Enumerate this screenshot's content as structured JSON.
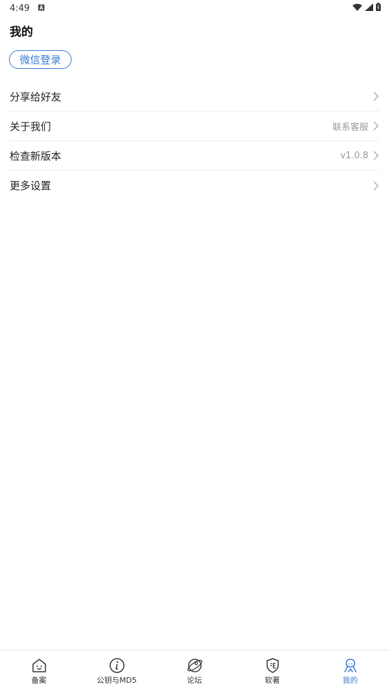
{
  "status_bar": {
    "time": "4:49"
  },
  "page_title": "我的",
  "login_button": "微信登录",
  "menu": [
    {
      "label": "分享给好友",
      "value": ""
    },
    {
      "label": "关于我们",
      "value": "联系客服"
    },
    {
      "label": "检查新版本",
      "value": "v1.0.8"
    },
    {
      "label": "更多设置",
      "value": ""
    }
  ],
  "bottom_nav": [
    {
      "label": "备案",
      "icon": "house-face-icon",
      "active": false
    },
    {
      "label": "公钥与MD5",
      "icon": "info-icon",
      "active": false
    },
    {
      "label": "论坛",
      "icon": "planet-icon",
      "active": false
    },
    {
      "label": "软著",
      "icon": "certificate-shield-icon",
      "active": false
    },
    {
      "label": "我的",
      "icon": "person-icon",
      "active": true
    }
  ],
  "colors": {
    "accent": "#3a7bd5",
    "divider": "#eeeeee",
    "muted": "#999999"
  }
}
